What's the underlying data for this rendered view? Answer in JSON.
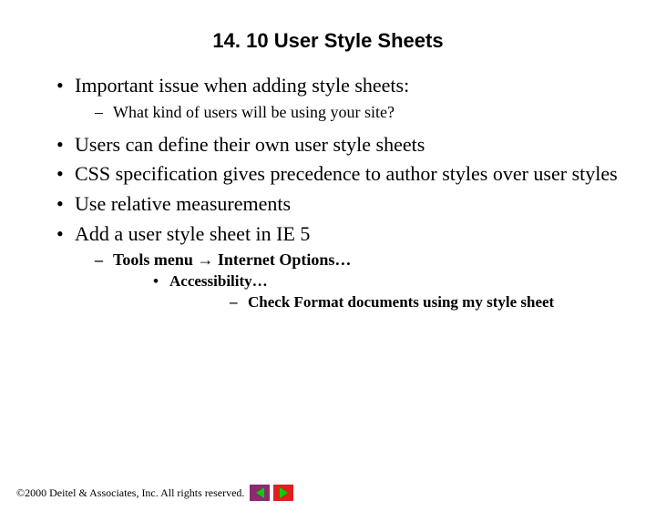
{
  "title": "14. 10 User Style Sheets",
  "bullets": {
    "b1": "Important issue when adding style sheets:",
    "b1_1": "What kind of users will be using your site?",
    "b2": "Users can define their own user style sheets",
    "b3": "CSS specification gives precedence to author styles over user styles",
    "b4": "Use relative measurements",
    "b5": "Add a user style sheet in IE 5",
    "b5_1_pre": "Tools menu ",
    "b5_1_arrow": "→",
    "b5_1_post": " Internet Options…",
    "b5_1_1": "Accessibility…",
    "b5_1_1_1": "Check Format documents using my style sheet"
  },
  "footer": {
    "copyright_symbol": "©",
    "text": " 2000 Deitel & Associates, Inc.  All rights reserved."
  }
}
